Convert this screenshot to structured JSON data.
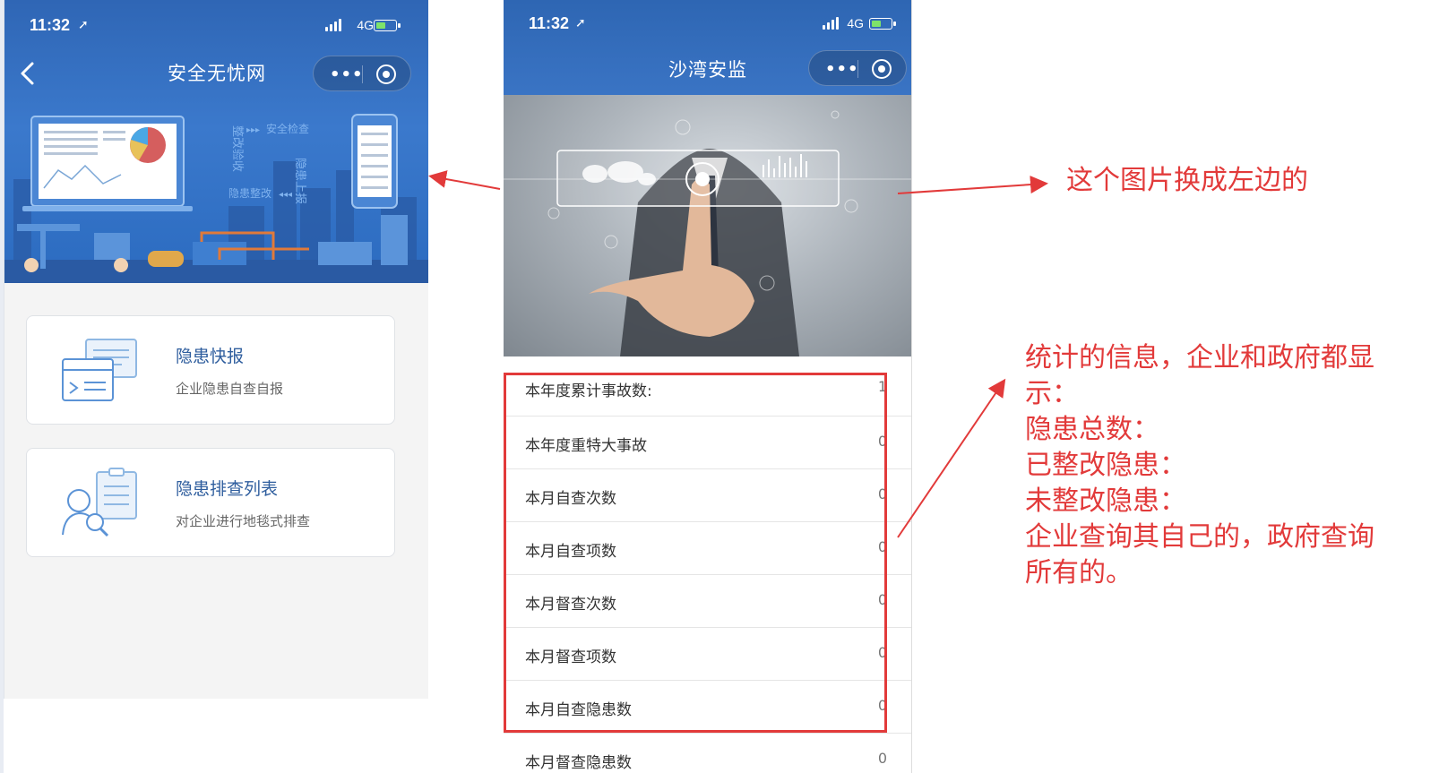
{
  "left_phone": {
    "status": {
      "time": "11:32",
      "network": "4G"
    },
    "title": "安全无忧网",
    "banner": {
      "rectify_acceptance": "整改验收",
      "safety_check": "安全检查",
      "hazard_rectify": "隐患整改",
      "hazard_report": "隐患上报"
    },
    "cards": [
      {
        "title": "隐患快报",
        "subtitle": "企业隐患自查自报",
        "icon": "form-report-icon"
      },
      {
        "title": "隐患排查列表",
        "subtitle": "对企业进行地毯式排查",
        "icon": "person-search-icon"
      }
    ]
  },
  "right_phone": {
    "status": {
      "time": "11:32",
      "network": "4G"
    },
    "title": "沙湾安监",
    "rows": [
      {
        "label": "本年度累计事故数:",
        "value": "1"
      },
      {
        "label": "本年度重特大事故",
        "value": "0"
      },
      {
        "label": "本月自查次数",
        "value": "0"
      },
      {
        "label": "本月自查项数",
        "value": "0"
      },
      {
        "label": "本月督查次数",
        "value": "0"
      },
      {
        "label": "本月督查项数",
        "value": "0"
      },
      {
        "label": "本月自查隐患数",
        "value": "0"
      },
      {
        "label": "本月督查隐患数",
        "value": "0"
      }
    ]
  },
  "annotations": {
    "replace_image": "这个图片换成左边的",
    "stats_lines": [
      "统计的信息，企业和政府都显",
      "示：",
      "隐患总数：",
      "已整改隐患：",
      "未整改隐患：",
      "企业查询其自己的，政府查询",
      "所有的。"
    ],
    "color": "#e23a3a"
  }
}
